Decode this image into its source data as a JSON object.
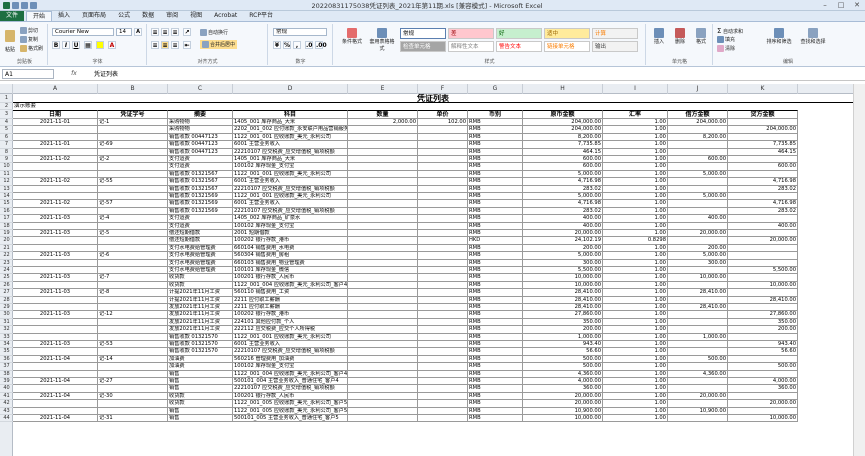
{
  "title": "20220831175038凭证列表_2021年第11期.xls [兼容模式] - Microsoft Excel",
  "tabs": [
    "文件",
    "开始",
    "插入",
    "页面布局",
    "公式",
    "数据",
    "审阅",
    "视图",
    "Acrobat",
    "RCP平台"
  ],
  "ribbon": {
    "clipboard": {
      "cut": "剪切",
      "copy": "复制",
      "paste": "粘贴",
      "format_painter": "格式刷",
      "label": "剪贴板"
    },
    "font": {
      "name": "Courier New",
      "size": "14",
      "bold": "B",
      "italic": "I",
      "underline": "U",
      "label": "字体"
    },
    "alignment": {
      "wrap": "自动换行",
      "merge": "合并后居中",
      "label": "对齐方式"
    },
    "number": {
      "format": "常规",
      "label": "数字"
    },
    "styles": {
      "conditional": "条件格式",
      "table": "套用表格格式",
      "label": "样式",
      "cells": [
        {
          "text": "常规",
          "bg": "#ffffff",
          "fg": "#000000"
        },
        {
          "text": "差",
          "bg": "#ffc7ce",
          "fg": "#9c0006"
        },
        {
          "text": "好",
          "bg": "#c6efce",
          "fg": "#006100"
        },
        {
          "text": "适中",
          "bg": "#ffeb9c",
          "fg": "#9c6500"
        },
        {
          "text": "计算",
          "bg": "#f2f2f2",
          "fg": "#fa7d00"
        },
        {
          "text": "检查单元格",
          "bg": "#a5a5a5",
          "fg": "#ffffff"
        },
        {
          "text": "解释性文本",
          "bg": "#ffffff",
          "fg": "#7f7f7f"
        },
        {
          "text": "警告文本",
          "bg": "#ffffff",
          "fg": "#ff0000"
        },
        {
          "text": "链接单元格",
          "bg": "#ffffff",
          "fg": "#fa7d00"
        },
        {
          "text": "输出",
          "bg": "#f2f2f2",
          "fg": "#3f3f3f"
        }
      ]
    },
    "cells_group": {
      "insert": "插入",
      "delete": "删除",
      "format": "格式",
      "label": "单元格"
    },
    "editing": {
      "autosum": "自动求和",
      "fill": "填充",
      "clear": "清除",
      "sort": "排序和筛选",
      "find": "查找和选择",
      "label": "编辑"
    }
  },
  "formula": {
    "name_box": "A1",
    "fx": "fx",
    "value": "凭证列表"
  },
  "columns": [
    "A",
    "B",
    "C",
    "D",
    "E",
    "F",
    "G",
    "H",
    "I",
    "J",
    "K"
  ],
  "sheet": {
    "title": "凭证列表",
    "subtitle": "演示账套",
    "headers": [
      "日期",
      "凭证字号",
      "摘要",
      "科目",
      "数量",
      "单价",
      "币别",
      "原币金额",
      "汇率",
      "借方金额",
      "贷方金额"
    ],
    "rows": [
      {
        "n": "4",
        "date": "2021-11-01",
        "voucher": "记-1",
        "summary": "采购物物",
        "account": "1405_001 库存商品_大米",
        "qty": "2,000.00",
        "price": "102.00",
        "cur": "RMB",
        "amount": "204,000.00",
        "rate": "1.00",
        "debit": "204,000.00",
        "credit": ""
      },
      {
        "n": "5",
        "date": "",
        "voucher": "",
        "summary": "采购物物",
        "account": "2202_001_002 应付账款_永安联户用品营销服务中心有限公司",
        "qty": "",
        "price": "",
        "cur": "RMB",
        "amount": "204,000.00",
        "rate": "1.00",
        "debit": "",
        "credit": "204,000.00"
      },
      {
        "n": "6",
        "date": "",
        "voucher": "",
        "summary": "销售收款 00447123",
        "account": "1122_001_001 应收账款_美元_永利公司",
        "qty": "",
        "price": "",
        "cur": "RMB",
        "amount": "8,200.00",
        "rate": "1.00",
        "debit": "8,200.00",
        "credit": ""
      },
      {
        "n": "7",
        "date": "2021-11-01",
        "voucher": "记-69",
        "summary": "销售收款 00447123",
        "account": "6001 主营业务收入",
        "qty": "",
        "price": "",
        "cur": "RMB",
        "amount": "7,735.85",
        "rate": "1.00",
        "debit": "",
        "credit": "7,735.85"
      },
      {
        "n": "8",
        "date": "",
        "voucher": "",
        "summary": "销售收款 00447123",
        "account": "22210107 应交税费_应交增值税_销项税额",
        "qty": "",
        "price": "",
        "cur": "RMB",
        "amount": "464.15",
        "rate": "1.00",
        "debit": "",
        "credit": "464.15"
      },
      {
        "n": "9",
        "date": "2021-11-02",
        "voucher": "记-2",
        "summary": "支付运费",
        "account": "1405_001 库存商品_大米",
        "qty": "",
        "price": "",
        "cur": "RMB",
        "amount": "600.00",
        "rate": "1.00",
        "debit": "600.00",
        "credit": ""
      },
      {
        "n": "10",
        "date": "",
        "voucher": "",
        "summary": "支付运费",
        "account": "100102 库存现金_支付宝",
        "qty": "",
        "price": "",
        "cur": "RMB",
        "amount": "600.00",
        "rate": "1.00",
        "debit": "",
        "credit": "600.00"
      },
      {
        "n": "11",
        "date": "",
        "voucher": "",
        "summary": "销售收款 01321567",
        "account": "1122_001_001 应收账款_美元_永利公司",
        "qty": "",
        "price": "",
        "cur": "RMB",
        "amount": "5,000.00",
        "rate": "1.00",
        "debit": "5,000.00",
        "credit": ""
      },
      {
        "n": "12",
        "date": "2021-11-02",
        "voucher": "记-55",
        "summary": "销售收款 01321567",
        "account": "6001 主营业务收入",
        "qty": "",
        "price": "",
        "cur": "RMB",
        "amount": "4,716.98",
        "rate": "1.00",
        "debit": "",
        "credit": "4,716.98"
      },
      {
        "n": "13",
        "date": "",
        "voucher": "",
        "summary": "销售收款 01321567",
        "account": "22210107 应交税费_应交增值税_销项税额",
        "qty": "",
        "price": "",
        "cur": "RMB",
        "amount": "283.02",
        "rate": "1.00",
        "debit": "",
        "credit": "283.02"
      },
      {
        "n": "14",
        "date": "",
        "voucher": "",
        "summary": "销售收款 01321569",
        "account": "1122_001_001 应收账款_美元_永利公司",
        "qty": "",
        "price": "",
        "cur": "RMB",
        "amount": "5,000.00",
        "rate": "1.00",
        "debit": "5,000.00",
        "credit": ""
      },
      {
        "n": "15",
        "date": "2021-11-02",
        "voucher": "记-57",
        "summary": "销售收款 01321569",
        "account": "6001 主营业务收入",
        "qty": "",
        "price": "",
        "cur": "RMB",
        "amount": "4,716.98",
        "rate": "1.00",
        "debit": "",
        "credit": "4,716.98"
      },
      {
        "n": "16",
        "date": "",
        "voucher": "",
        "summary": "销售收款 01321569",
        "account": "22210107 应交税费_应交增值税_销项税额",
        "qty": "",
        "price": "",
        "cur": "RMB",
        "amount": "283.02",
        "rate": "1.00",
        "debit": "",
        "credit": "283.02"
      },
      {
        "n": "17",
        "date": "2021-11-03",
        "voucher": "记-4",
        "summary": "支付运费",
        "account": "1405_002 库存商品_矿泉水",
        "qty": "",
        "price": "",
        "cur": "RMB",
        "amount": "400.00",
        "rate": "1.00",
        "debit": "400.00",
        "credit": ""
      },
      {
        "n": "18",
        "date": "",
        "voucher": "",
        "summary": "支付运费",
        "account": "100102 库存现金_支付宝",
        "qty": "",
        "price": "",
        "cur": "RMB",
        "amount": "400.00",
        "rate": "1.00",
        "debit": "",
        "credit": "400.00"
      },
      {
        "n": "19",
        "date": "2021-11-03",
        "voucher": "记-5",
        "summary": "偿还短期借款",
        "account": "2001 短期借款",
        "qty": "",
        "price": "",
        "cur": "RMB",
        "amount": "20,000.00",
        "rate": "1.00",
        "debit": "20,000.00",
        "credit": ""
      },
      {
        "n": "20",
        "date": "",
        "voucher": "",
        "summary": "偿还短期借款",
        "account": "100202 银行存款_港币",
        "qty": "",
        "price": "",
        "cur": "HKD",
        "amount": "24,102.19",
        "rate": "0.8298",
        "debit": "",
        "credit": "20,000.00"
      },
      {
        "n": "21",
        "date": "",
        "voucher": "",
        "summary": "支付水电费给管理费",
        "account": "660104 销售费用_水电费",
        "qty": "",
        "price": "",
        "cur": "RMB",
        "amount": "200.00",
        "rate": "1.00",
        "debit": "200.00",
        "credit": ""
      },
      {
        "n": "22",
        "date": "2021-11-03",
        "voucher": "记-6",
        "summary": "支付水电费给管理费",
        "account": "560304 销售费用_房租",
        "qty": "",
        "price": "",
        "cur": "RMB",
        "amount": "5,000.00",
        "rate": "1.00",
        "debit": "5,000.00",
        "credit": ""
      },
      {
        "n": "23",
        "date": "",
        "voucher": "",
        "summary": "支付水电费给管理费",
        "account": "660103 销售费用_物业管理费",
        "qty": "",
        "price": "",
        "cur": "RMB",
        "amount": "300.00",
        "rate": "1.00",
        "debit": "300.00",
        "credit": ""
      },
      {
        "n": "24",
        "date": "",
        "voucher": "",
        "summary": "支付水电费给管理费",
        "account": "100101 库存现金_微信",
        "qty": "",
        "price": "",
        "cur": "RMB",
        "amount": "5,500.00",
        "rate": "1.00",
        "debit": "",
        "credit": "5,500.00"
      },
      {
        "n": "25",
        "date": "2021-11-03",
        "voucher": "记-7",
        "summary": "收货款",
        "account": "100201 银行存款_人民币",
        "qty": "",
        "price": "",
        "cur": "RMB",
        "amount": "10,000.00",
        "rate": "1.00",
        "debit": "10,000.00",
        "credit": ""
      },
      {
        "n": "26",
        "date": "",
        "voucher": "",
        "summary": "收货款",
        "account": "1122_001_004 应收账款_美元_永利公司_客户4",
        "qty": "",
        "price": "",
        "cur": "RMB",
        "amount": "10,000.00",
        "rate": "1.00",
        "debit": "",
        "credit": "10,000.00"
      },
      {
        "n": "27",
        "date": "2021-11-03",
        "voucher": "记-8",
        "summary": "计提2021年11月工资",
        "account": "560110 销售费用_工资",
        "qty": "",
        "price": "",
        "cur": "RMB",
        "amount": "28,410.00",
        "rate": "1.00",
        "debit": "28,410.00",
        "credit": ""
      },
      {
        "n": "28",
        "date": "",
        "voucher": "",
        "summary": "计提2021年11月工资",
        "account": "2211 应付职工薪酬",
        "qty": "",
        "price": "",
        "cur": "RMB",
        "amount": "28,410.00",
        "rate": "1.00",
        "debit": "",
        "credit": "28,410.00"
      },
      {
        "n": "29",
        "date": "",
        "voucher": "",
        "summary": "发放2021年11月工资",
        "account": "2211 应付职工薪酬",
        "qty": "",
        "price": "",
        "cur": "RMB",
        "amount": "28,410.00",
        "rate": "1.00",
        "debit": "28,410.00",
        "credit": ""
      },
      {
        "n": "30",
        "date": "2021-11-03",
        "voucher": "记-12",
        "summary": "发放2021年11月工资",
        "account": "100202 银行存款_港币",
        "qty": "",
        "price": "",
        "cur": "RMB",
        "amount": "27,860.00",
        "rate": "1.00",
        "debit": "",
        "credit": "27,860.00"
      },
      {
        "n": "31",
        "date": "",
        "voucher": "",
        "summary": "发放2021年11月工资",
        "account": "224101 其他应付款_个人",
        "qty": "",
        "price": "",
        "cur": "RMB",
        "amount": "350.00",
        "rate": "1.00",
        "debit": "",
        "credit": "350.00"
      },
      {
        "n": "32",
        "date": "",
        "voucher": "",
        "summary": "发放2021年11月工资",
        "account": "222112 应交税费_应交个人所得税",
        "qty": "",
        "price": "",
        "cur": "RMB",
        "amount": "200.00",
        "rate": "1.00",
        "debit": "",
        "credit": "200.00"
      },
      {
        "n": "33",
        "date": "",
        "voucher": "",
        "summary": "销售收款 01321570",
        "account": "1122_001_001 应收账款_美元_永利公司",
        "qty": "",
        "price": "",
        "cur": "RMB",
        "amount": "1,000.00",
        "rate": "1.00",
        "debit": "1,000.00",
        "credit": ""
      },
      {
        "n": "34",
        "date": "2021-11-03",
        "voucher": "记-53",
        "summary": "销售收款 01321570",
        "account": "6001 主营业务收入",
        "qty": "",
        "price": "",
        "cur": "RMB",
        "amount": "943.40",
        "rate": "1.00",
        "debit": "",
        "credit": "943.40"
      },
      {
        "n": "35",
        "date": "",
        "voucher": "",
        "summary": "销售收款 01321570",
        "account": "22210107 应交税费_应交增值税_销项税额",
        "qty": "",
        "price": "",
        "cur": "RMB",
        "amount": "56.60",
        "rate": "1.00",
        "debit": "",
        "credit": "56.60"
      },
      {
        "n": "36",
        "date": "2021-11-04",
        "voucher": "记-14",
        "summary": "加油费",
        "account": "560216 管理费用_加油费",
        "qty": "",
        "price": "",
        "cur": "RMB",
        "amount": "500.00",
        "rate": "1.00",
        "debit": "500.00",
        "credit": ""
      },
      {
        "n": "37",
        "date": "",
        "voucher": "",
        "summary": "加油费",
        "account": "100102 库存现金_支付宝",
        "qty": "",
        "price": "",
        "cur": "RMB",
        "amount": "500.00",
        "rate": "1.00",
        "debit": "",
        "credit": "500.00"
      },
      {
        "n": "38",
        "date": "",
        "voucher": "",
        "summary": "销售",
        "account": "1122_001_004 应收账款_美元_永利公司_客户4",
        "qty": "",
        "price": "",
        "cur": "RMB",
        "amount": "4,360.00",
        "rate": "1.00",
        "debit": "4,360.00",
        "credit": ""
      },
      {
        "n": "39",
        "date": "2021-11-04",
        "voucher": "记-27",
        "summary": "销售",
        "account": "500101_004 主营业务收入_普通住宅_客户4",
        "qty": "",
        "price": "",
        "cur": "RMB",
        "amount": "4,000.00",
        "rate": "1.00",
        "debit": "",
        "credit": "4,000.00"
      },
      {
        "n": "40",
        "date": "",
        "voucher": "",
        "summary": "销售",
        "account": "22210107 应交税费_应交增值税_销项税额",
        "qty": "",
        "price": "",
        "cur": "RMB",
        "amount": "360.00",
        "rate": "1.00",
        "debit": "",
        "credit": "360.00"
      },
      {
        "n": "41",
        "date": "2021-11-04",
        "voucher": "记-30",
        "summary": "收货款",
        "account": "100201 银行存款_人民币",
        "qty": "",
        "price": "",
        "cur": "RMB",
        "amount": "20,000.00",
        "rate": "1.00",
        "debit": "20,000.00",
        "credit": ""
      },
      {
        "n": "42",
        "date": "",
        "voucher": "",
        "summary": "收货款",
        "account": "1122_001_005 应收账款_美元_永利公司_客户5",
        "qty": "",
        "price": "",
        "cur": "RMB",
        "amount": "20,000.00",
        "rate": "1.00",
        "debit": "",
        "credit": "20,000.00"
      },
      {
        "n": "43",
        "date": "",
        "voucher": "",
        "summary": "销售",
        "account": "1122_001_005 应收账款_美元_永利公司_客户5",
        "qty": "",
        "price": "",
        "cur": "RMB",
        "amount": "10,900.00",
        "rate": "1.00",
        "debit": "10,900.00",
        "credit": ""
      },
      {
        "n": "44",
        "date": "2021-11-04",
        "voucher": "记-31",
        "summary": "销售",
        "account": "500101_005 主营业务收入_普通住宅_客户5",
        "qty": "",
        "price": "",
        "cur": "RMB",
        "amount": "10,000.00",
        "rate": "1.00",
        "debit": "",
        "credit": "10,000.00"
      }
    ]
  }
}
